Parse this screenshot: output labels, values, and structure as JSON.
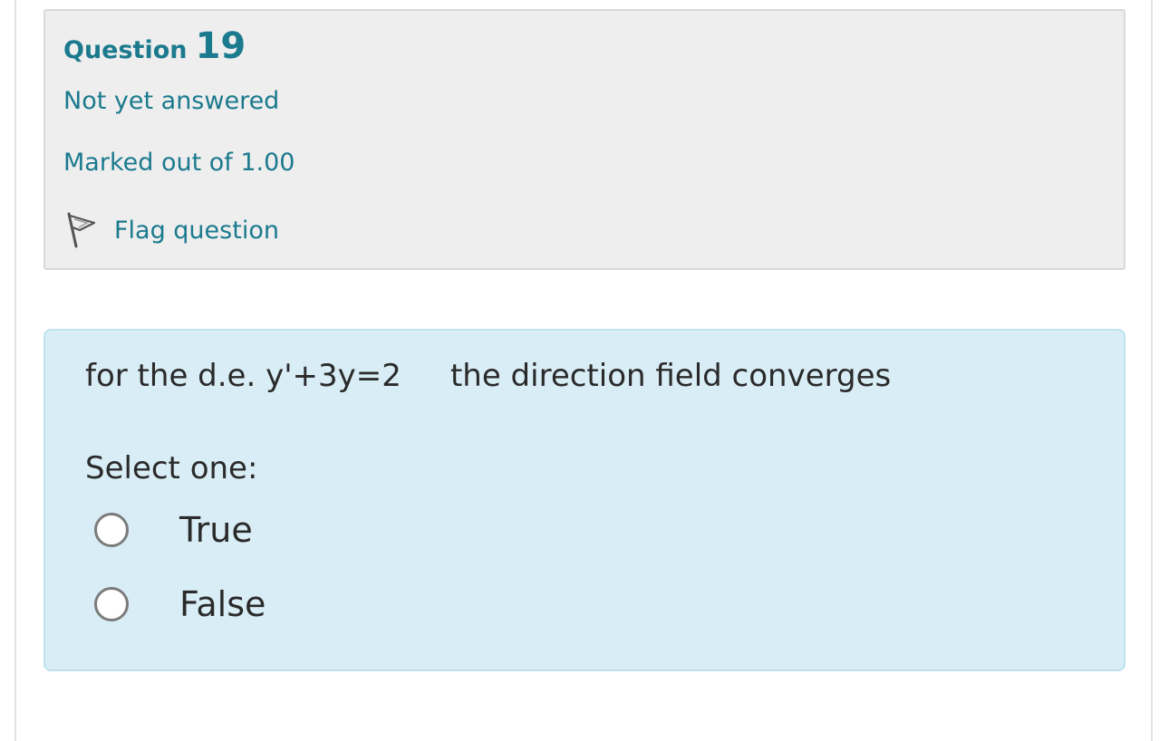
{
  "question_info": {
    "label": "Question",
    "number": "19",
    "state": "Not yet answered",
    "grade": "Marked out of 1.00",
    "flag_label": "Flag question",
    "flag_icon": "flag-outline-icon"
  },
  "question": {
    "text": "for the d.e. y'+3y=2     the direction field converges",
    "prompt": "Select one:",
    "options": [
      {
        "label": "True",
        "selected": false
      },
      {
        "label": "False",
        "selected": false
      }
    ]
  },
  "colors": {
    "accent": "#1b7a8e",
    "info_background": "#eeeeee",
    "content_background": "#d9edf6",
    "content_border": "#bde3ee",
    "text": "#2a2a2a"
  }
}
